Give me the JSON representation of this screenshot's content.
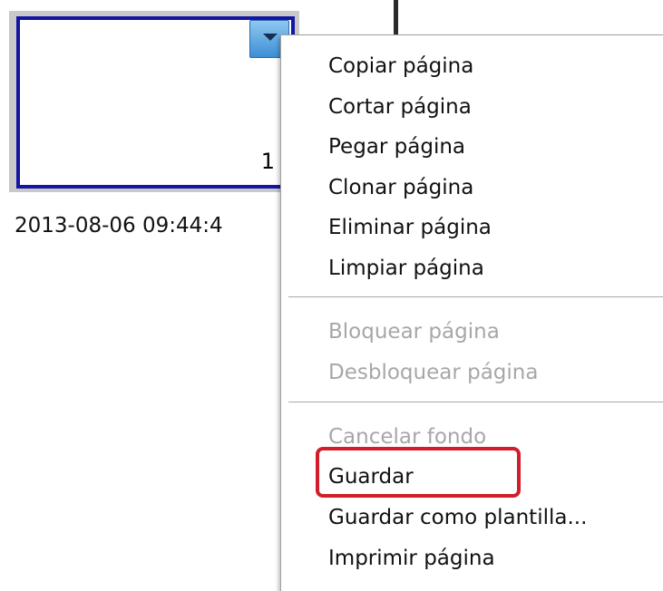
{
  "thumbnail": {
    "page_number": "1",
    "timestamp": "2013-08-06 09:44:4",
    "dropdown_icon": "chevron-down-icon"
  },
  "menu": {
    "items": [
      {
        "label": "Copiar página",
        "enabled": true
      },
      {
        "label": "Cortar página",
        "enabled": true
      },
      {
        "label": "Pegar página",
        "enabled": true
      },
      {
        "label": "Clonar página",
        "enabled": true
      },
      {
        "label": "Eliminar página",
        "enabled": true
      },
      {
        "label": "Limpiar página",
        "enabled": true
      },
      {
        "label": "Bloquear página",
        "enabled": false
      },
      {
        "label": "Desbloquear página",
        "enabled": false
      },
      {
        "label": "Cancelar fondo",
        "enabled": false
      },
      {
        "label": "Guardar",
        "enabled": true,
        "highlighted": true
      },
      {
        "label": "Guardar como plantilla...",
        "enabled": true
      },
      {
        "label": "Imprimir página",
        "enabled": true
      }
    ]
  },
  "colors": {
    "page_border": "#1515a3",
    "highlight_box": "#d21d2a",
    "disabled_text": "#a7a7a7"
  }
}
